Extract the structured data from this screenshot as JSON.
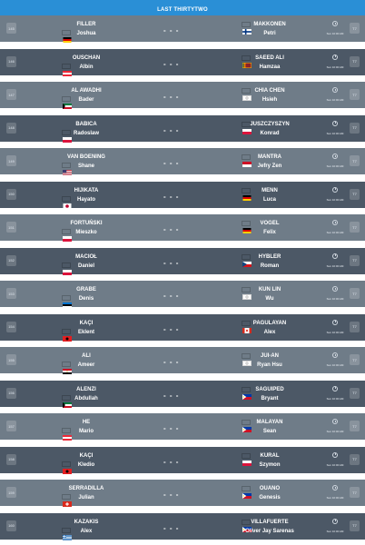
{
  "header": {
    "title": "LAST THIRTYTWO"
  },
  "colors": {
    "header_bg": "#2a8fd6",
    "row_light": "#6f7c88",
    "row_dark": "#4c5866"
  },
  "matches": [
    {
      "num": "145",
      "p1": {
        "sur": "FILLER",
        "fn": "Joshua",
        "flag": "DE"
      },
      "p2": {
        "sur": "MAKKONEN",
        "fn": "Petri",
        "flag": "FI"
      },
      "score": "- - -",
      "time": "Sun 10:00 AM",
      "badge": "T7"
    },
    {
      "num": "146",
      "p1": {
        "sur": "OUSCHAN",
        "fn": "Albin",
        "flag": "AT"
      },
      "p2": {
        "sur": "SAEED ALI",
        "fn": "Hamzaa",
        "flag": "LK"
      },
      "score": "- - -",
      "time": "Sun 10:00 AM",
      "badge": "T7"
    },
    {
      "num": "147",
      "p1": {
        "sur": "AL AWADHI",
        "fn": "Bader",
        "flag": "KW"
      },
      "p2": {
        "sur": "CHIA CHEN",
        "fn": "Hsieh",
        "flag": "TW"
      },
      "score": "- - -",
      "time": "Sun 10:00 AM",
      "badge": "T7"
    },
    {
      "num": "148",
      "p1": {
        "sur": "BABICA",
        "fn": "Radoslaw",
        "flag": "PL"
      },
      "p2": {
        "sur": "JUSZCZYSZYN",
        "fn": "Konrad",
        "flag": "PL"
      },
      "score": "- - -",
      "time": "Sun 10:00 AM",
      "badge": "T7"
    },
    {
      "num": "149",
      "p1": {
        "sur": "VAN BOENING",
        "fn": "Shane",
        "flag": "US"
      },
      "p2": {
        "sur": "MANTRA",
        "fn": "Jefry Zen",
        "flag": "ID"
      },
      "score": "- - -",
      "time": "Sun 10:00 AM",
      "badge": "T7"
    },
    {
      "num": "150",
      "p1": {
        "sur": "HIJIKATA",
        "fn": "Hayato",
        "flag": "JP"
      },
      "p2": {
        "sur": "MENN",
        "fn": "Luca",
        "flag": "DE"
      },
      "score": "- - -",
      "time": "Sun 10:00 AM",
      "badge": "T7"
    },
    {
      "num": "151",
      "p1": {
        "sur": "FORTUŃSKI",
        "fn": "Mieszko",
        "flag": "PL"
      },
      "p2": {
        "sur": "VOGEL",
        "fn": "Felix",
        "flag": "DE"
      },
      "score": "- - -",
      "time": "Sun 10:00 AM",
      "badge": "T7"
    },
    {
      "num": "152",
      "p1": {
        "sur": "MACIOŁ",
        "fn": "Daniel",
        "flag": "PL"
      },
      "p2": {
        "sur": "HYBLER",
        "fn": "Roman",
        "flag": "CZ"
      },
      "score": "- - -",
      "time": "Sun 10:00 AM",
      "badge": "T7"
    },
    {
      "num": "153",
      "p1": {
        "sur": "GRABE",
        "fn": "Denis",
        "flag": "EE"
      },
      "p2": {
        "sur": "KUN LIN",
        "fn": "Wu",
        "flag": "TW"
      },
      "score": "- - -",
      "time": "Sun 10:00 AM",
      "badge": "T7"
    },
    {
      "num": "154",
      "p1": {
        "sur": "KAÇI",
        "fn": "Eklent",
        "flag": "AL"
      },
      "p2": {
        "sur": "PAGULAYAN",
        "fn": "Alex",
        "flag": "CA"
      },
      "score": "- - -",
      "time": "Sun 10:00 AM",
      "badge": "T7"
    },
    {
      "num": "155",
      "p1": {
        "sur": "ALI",
        "fn": "Ameer",
        "flag": "EG"
      },
      "p2": {
        "sur": "JUI-AN",
        "fn": "Ryan Hsu",
        "flag": "TW"
      },
      "score": "- - -",
      "time": "Sun 10:00 AM",
      "badge": "T7"
    },
    {
      "num": "156",
      "p1": {
        "sur": "ALENZI",
        "fn": "Abdullah",
        "flag": "KW"
      },
      "p2": {
        "sur": "SAGUIPED",
        "fn": "Bryant",
        "flag": "PH"
      },
      "score": "- - -",
      "time": "Sun 10:00 AM",
      "badge": "T7"
    },
    {
      "num": "157",
      "p1": {
        "sur": "HE",
        "fn": "Mario",
        "flag": "AT"
      },
      "p2": {
        "sur": "MALAYAN",
        "fn": "Sean",
        "flag": "PH"
      },
      "score": "- - -",
      "time": "Sun 10:00 AM",
      "badge": "T7"
    },
    {
      "num": "158",
      "p1": {
        "sur": "KAÇI",
        "fn": "Kledio",
        "flag": "AL"
      },
      "p2": {
        "sur": "KURAL",
        "fn": "Szymon",
        "flag": "PL"
      },
      "score": "- - -",
      "time": "Sun 10:00 AM",
      "badge": "T7"
    },
    {
      "num": "159",
      "p1": {
        "sur": "SERRADILLA",
        "fn": "Julian",
        "flag": "CH"
      },
      "p2": {
        "sur": "OUANO",
        "fn": "Genesis",
        "flag": "PH"
      },
      "score": "- - -",
      "time": "Sun 10:00 AM",
      "badge": "T7"
    },
    {
      "num": "160",
      "p1": {
        "sur": "KAZAKIS",
        "fn": "Alex",
        "flag": "GR"
      },
      "p2": {
        "sur": "VILLAFUERTE",
        "fn": "Oliver Jay Sarenas",
        "flag": "PH"
      },
      "score": "- - -",
      "time": "Sun 10:00 AM",
      "badge": "T7"
    }
  ]
}
